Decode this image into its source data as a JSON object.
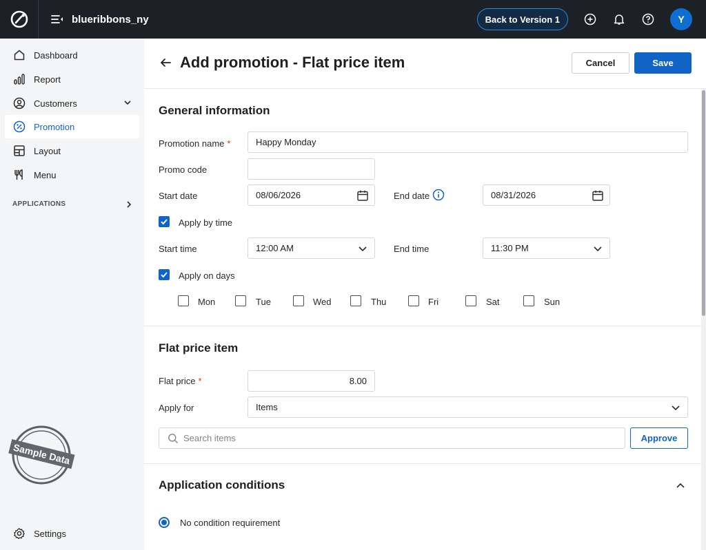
{
  "topbar": {
    "store_name": "blueribbons_ny",
    "back_button": "Back to Version 1",
    "avatar_initial": "Y"
  },
  "sidebar": {
    "items": [
      {
        "label": "Dashboard",
        "icon": "home-icon"
      },
      {
        "label": "Report",
        "icon": "bar-chart-icon"
      },
      {
        "label": "Customers",
        "icon": "user-circle-icon"
      },
      {
        "label": "Promotion",
        "icon": "percent-icon"
      },
      {
        "label": "Layout",
        "icon": "layout-icon"
      },
      {
        "label": "Menu",
        "icon": "fork-knife-icon"
      }
    ],
    "applications_label": "APPLICATIONS",
    "settings_label": "Settings",
    "stamp_text": "Sample Data"
  },
  "header": {
    "title": "Add promotion - Flat price item",
    "cancel_label": "Cancel",
    "save_label": "Save"
  },
  "general": {
    "section_title": "General information",
    "promotion_name_label": "Promotion name",
    "promotion_name_value": "Happy Monday",
    "promo_code_label": "Promo code",
    "promo_code_value": "",
    "start_date_label": "Start date",
    "start_date_value": "08/06/2026",
    "end_date_label": "End date",
    "end_date_value": "08/31/2026",
    "apply_by_time_label": "Apply by time",
    "apply_by_time_checked": true,
    "start_time_label": "Start time",
    "start_time_value": "12:00 AM",
    "end_time_label": "End time",
    "end_time_value": "11:30 PM",
    "apply_on_days_label": "Apply on days",
    "apply_on_days_checked": true,
    "days": [
      {
        "label": "Mon",
        "checked": false
      },
      {
        "label": "Tue",
        "checked": false
      },
      {
        "label": "Wed",
        "checked": false
      },
      {
        "label": "Thu",
        "checked": false
      },
      {
        "label": "Fri",
        "checked": false
      },
      {
        "label": "Sat",
        "checked": false
      },
      {
        "label": "Sun",
        "checked": false
      }
    ]
  },
  "flat_price": {
    "section_title": "Flat price item",
    "flat_price_label": "Flat price",
    "flat_price_value": "8.00",
    "apply_for_label": "Apply for",
    "apply_for_value": "Items",
    "search_placeholder": "Search items",
    "approve_label": "Approve"
  },
  "conditions": {
    "section_title": "Application conditions",
    "option_label": "No condition requirement"
  },
  "colors": {
    "accent": "#1263c6",
    "topbar_bg": "#1c2127",
    "sidebar_bg": "#f4f5f6",
    "required": "#d93025"
  }
}
